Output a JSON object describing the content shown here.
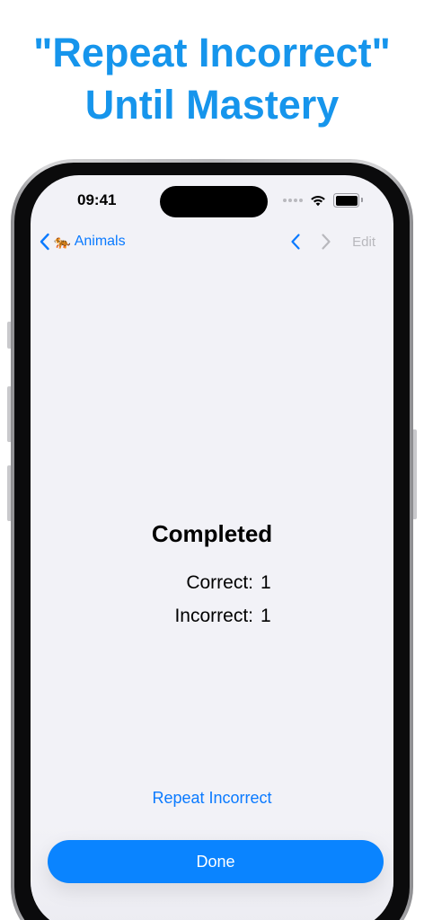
{
  "headline": {
    "line1": "\"Repeat Incorrect\"",
    "line2": "Until Mastery"
  },
  "status_bar": {
    "time": "09:41"
  },
  "nav": {
    "back_emoji": "🐅",
    "back_label": "Animals",
    "edit_label": "Edit"
  },
  "result": {
    "title": "Completed",
    "rows": [
      {
        "label": "Correct:",
        "value": "1"
      },
      {
        "label": "Incorrect:",
        "value": "1"
      }
    ]
  },
  "actions": {
    "repeat_label": "Repeat Incorrect",
    "done_label": "Done"
  },
  "colors": {
    "headline": "#1695ec",
    "accent": "#0a7aff",
    "disabled": "#b8b8bd",
    "screen_bg": "#f2f2f7"
  },
  "icons": {
    "back": "chevron-left-icon",
    "previous": "chevron-left-icon",
    "next": "chevron-right-icon",
    "wifi": "wifi-icon",
    "battery": "battery-icon",
    "signal": "cellular-signal-icon"
  }
}
